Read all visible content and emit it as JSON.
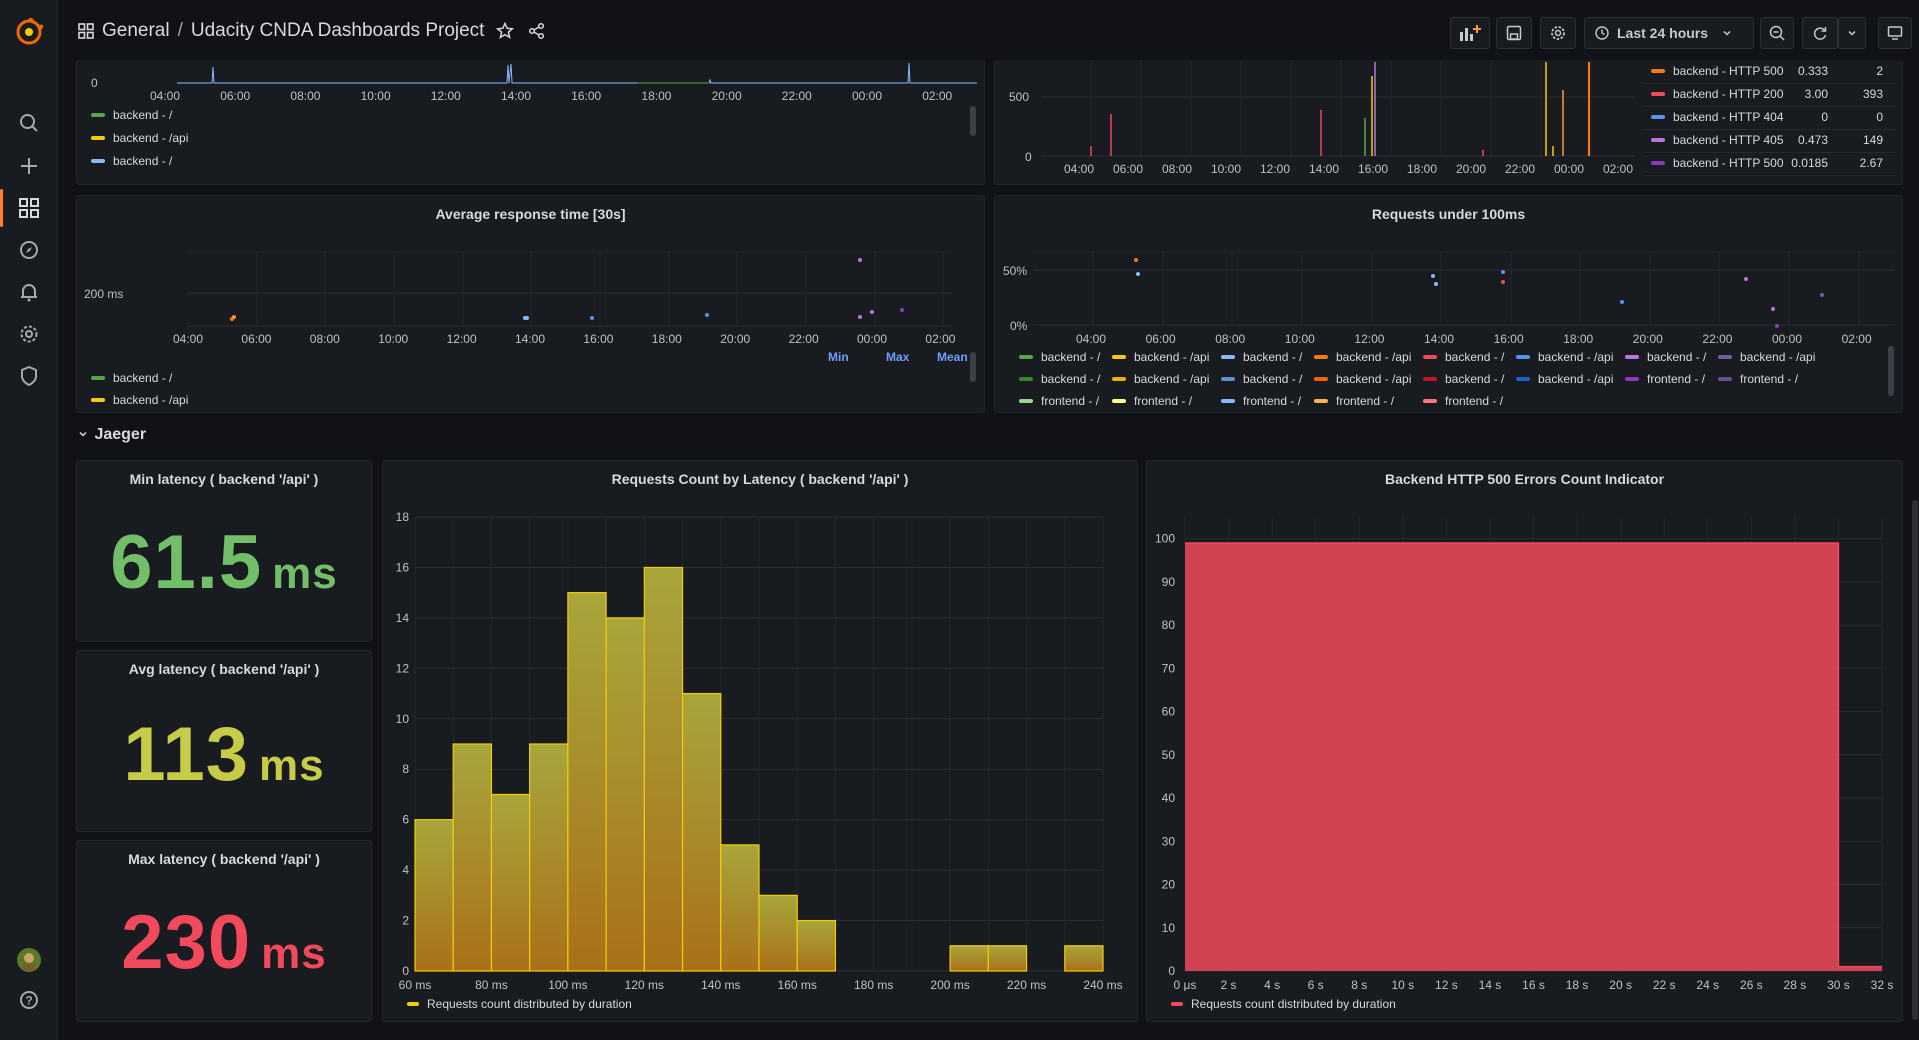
{
  "topbar": {
    "folder": "General",
    "separator": "/",
    "dashboard": "Udacity CNDA Dashboards Project",
    "time_range": "Last 24 hours"
  },
  "sidebar": {
    "icons": [
      "grafana-logo",
      "search-icon",
      "plus-icon",
      "dashboards-icon",
      "explore-icon",
      "alerting-icon",
      "settings-icon",
      "shield-icon",
      "avatar",
      "help-icon"
    ]
  },
  "top_left_panel": {
    "ticks": [
      "04:00",
      "06:00",
      "08:00",
      "10:00",
      "12:00",
      "14:00",
      "16:00",
      "18:00",
      "20:00",
      "22:00",
      "00:00",
      "02:00"
    ],
    "y_label": "0",
    "legend": [
      {
        "label": "backend - /",
        "color": "#56a64b"
      },
      {
        "label": "backend - /api",
        "color": "#f2cc0c"
      },
      {
        "label": "backend - /",
        "color": "#8ab8ff"
      }
    ]
  },
  "top_right_panel": {
    "ticks": [
      "04:00",
      "06:00",
      "08:00",
      "10:00",
      "12:00",
      "14:00",
      "16:00",
      "18:00",
      "20:00",
      "22:00",
      "00:00",
      "02:00"
    ],
    "y_labels": [
      "500",
      "0"
    ],
    "legend": [
      {
        "label": "backend - HTTP 500",
        "v1": "0.333",
        "v2": "2",
        "color": "#ff780a"
      },
      {
        "label": "backend - HTTP 200",
        "v1": "3.00",
        "v2": "393",
        "color": "#f2495c"
      },
      {
        "label": "backend - HTTP 404",
        "v1": "0",
        "v2": "0",
        "color": "#5794f2"
      },
      {
        "label": "backend - HTTP 405",
        "v1": "0.473",
        "v2": "149",
        "color": "#b877d9"
      },
      {
        "label": "backend - HTTP 500",
        "v1": "0.0185",
        "v2": "2.67",
        "color": "#8f3bb8"
      }
    ]
  },
  "avg_response": {
    "title": "Average response time [30s]",
    "y_label": "200 ms",
    "ticks": [
      "04:00",
      "06:00",
      "08:00",
      "10:00",
      "12:00",
      "14:00",
      "16:00",
      "18:00",
      "20:00",
      "22:00",
      "00:00",
      "02:00"
    ],
    "legend_headers": [
      "Min",
      "Max",
      "Mean"
    ],
    "legend": [
      {
        "label": "backend - /",
        "color": "#56a64b"
      },
      {
        "label": "backend - /api",
        "color": "#f2cc0c"
      }
    ]
  },
  "req_under": {
    "title": "Requests under 100ms",
    "y_labels": [
      "50%",
      "0%"
    ],
    "ticks": [
      "04:00",
      "06:00",
      "08:00",
      "10:00",
      "12:00",
      "14:00",
      "16:00",
      "18:00",
      "20:00",
      "22:00",
      "00:00",
      "02:00"
    ],
    "legend_row1": [
      {
        "label": "backend - /",
        "color": "#56a64b"
      },
      {
        "label": "backend - /api",
        "color": "#f2cc0c"
      },
      {
        "label": "backend - /",
        "color": "#8ab8ff"
      },
      {
        "label": "backend - /api",
        "color": "#ff780a"
      },
      {
        "label": "backend - /",
        "color": "#f2495c"
      },
      {
        "label": "backend - /api",
        "color": "#5794f2"
      },
      {
        "label": "backend - /",
        "color": "#b877d9"
      },
      {
        "label": "backend - /api",
        "color": "#705da0"
      }
    ],
    "legend_row2": [
      {
        "label": "backend - /",
        "color": "#37872d"
      },
      {
        "label": "backend - /api",
        "color": "#e0b400"
      },
      {
        "label": "backend - /",
        "color": "#5d8fd3"
      },
      {
        "label": "backend - /api",
        "color": "#fa6400"
      },
      {
        "label": "backend - /",
        "color": "#c4162a"
      },
      {
        "label": "backend - /api",
        "color": "#1f60c4"
      },
      {
        "label": "frontend - /",
        "color": "#8f3bb8"
      },
      {
        "label": "frontend - /",
        "color": "#6c4d96"
      }
    ],
    "legend_row3": [
      {
        "label": "frontend - /",
        "color": "#96d98d"
      },
      {
        "label": "frontend - /",
        "color": "#fff899"
      },
      {
        "label": "frontend - /",
        "color": "#8ab8ff"
      },
      {
        "label": "frontend - /",
        "color": "#ffb357"
      },
      {
        "label": "frontend - /",
        "color": "#ff7383"
      }
    ]
  },
  "row": {
    "title": "Jaeger"
  },
  "stats": {
    "min": {
      "title": "Min latency ( backend '/api' )",
      "value": "61.5",
      "unit": "ms",
      "color": "#73bf69"
    },
    "avg": {
      "title": "Avg latency ( backend '/api' )",
      "value": "113",
      "unit": "ms",
      "color": "#c6cc47"
    },
    "max": {
      "title": "Max latency ( backend '/api' )",
      "value": "230",
      "unit": "ms",
      "color": "#f2495c"
    }
  },
  "histogram": {
    "title": "Requests Count by Latency ( backend '/api' )",
    "legend": "Requests count distributed by duration"
  },
  "errors": {
    "title": "Backend HTTP 500 Errors Count Indicator",
    "legend": "Requests count distributed by duration"
  },
  "chart_data": [
    {
      "type": "bar",
      "title": "Requests Count by Latency ( backend '/api' )",
      "x_ticks": [
        "60 ms",
        "80 ms",
        "100 ms",
        "120 ms",
        "140 ms",
        "160 ms",
        "180 ms",
        "200 ms",
        "220 ms",
        "240 ms"
      ],
      "x": [
        60,
        70,
        80,
        90,
        100,
        110,
        120,
        130,
        140,
        150,
        160,
        170,
        180,
        190,
        200,
        210,
        220,
        230
      ],
      "values": [
        6,
        9,
        7,
        9,
        15,
        14,
        16,
        11,
        5,
        3,
        2,
        0,
        0,
        0,
        1,
        1,
        0,
        1
      ],
      "bin_width": 10,
      "y_ticks": [
        0,
        2,
        4,
        6,
        8,
        10,
        12,
        14,
        16,
        18
      ],
      "ylim": [
        0,
        18
      ],
      "xlim": [
        60,
        240
      ],
      "series": [
        {
          "name": "Requests count distributed by duration",
          "color": "#e0b400"
        }
      ]
    },
    {
      "type": "area",
      "title": "Backend HTTP 500 Errors Count Indicator",
      "x_ticks": [
        "0 μs",
        "2 s",
        "4 s",
        "6 s",
        "8 s",
        "10 s",
        "12 s",
        "14 s",
        "16 s",
        "18 s",
        "20 s",
        "22 s",
        "24 s",
        "26 s",
        "28 s",
        "30 s",
        "32 s"
      ],
      "x": [
        0,
        30,
        30,
        32
      ],
      "values": [
        99,
        99,
        1,
        1
      ],
      "y_ticks": [
        0,
        10,
        20,
        30,
        40,
        50,
        60,
        70,
        80,
        90,
        100
      ],
      "ylim": [
        0,
        100
      ],
      "xlim": [
        0,
        32
      ],
      "series": [
        {
          "name": "Requests count distributed by duration",
          "color": "#f2495c"
        }
      ]
    }
  ]
}
